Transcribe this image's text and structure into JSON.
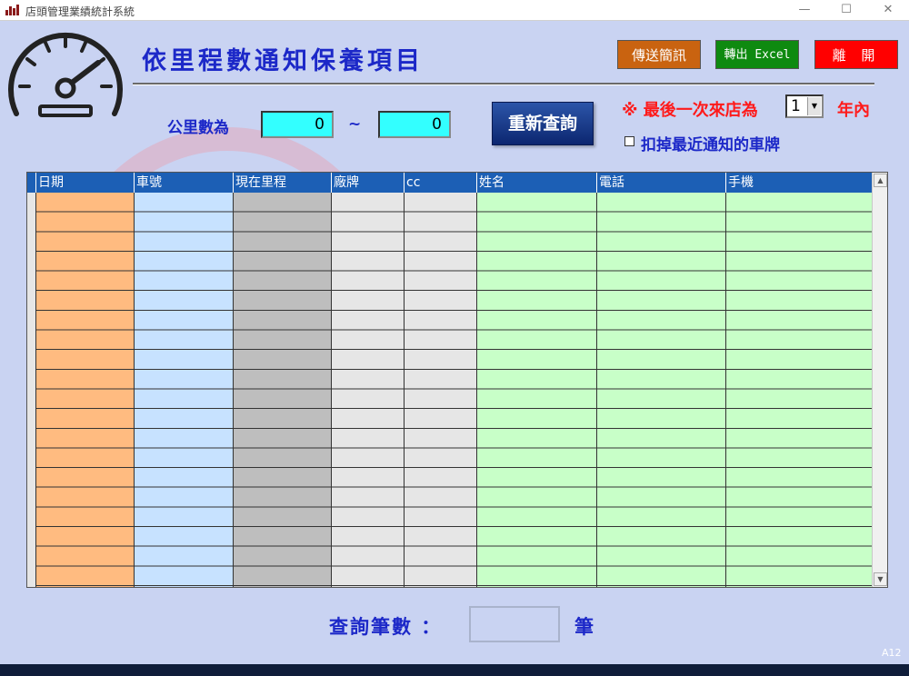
{
  "window": {
    "title": "店頭管理業績統計系統",
    "controls": [
      "—",
      "☐",
      "✕"
    ]
  },
  "header": {
    "page_title": "依里程數通知保養項目",
    "buttons": {
      "sms": "傳送簡訊",
      "excel": "轉出 Excel",
      "exit": "離 開"
    }
  },
  "filters": {
    "km_label": "公里數為",
    "km_from": "0",
    "km_separator": "~",
    "km_to": "0",
    "requery_label": "重新查詢",
    "last_visit_prefix": "※ 最後一次來店為",
    "last_visit_years": "1",
    "last_visit_suffix": "年內",
    "exclude_label": "扣掉最近通知的車牌",
    "exclude_checked": false
  },
  "grid": {
    "columns": [
      {
        "label": "日期",
        "color": "#ffbb80"
      },
      {
        "label": "車號",
        "color": "#c7e2ff"
      },
      {
        "label": "現在里程",
        "color": "#bebebe"
      },
      {
        "label": "廠牌",
        "color": "#e6e6e6"
      },
      {
        "label": "cc",
        "color": "#e6e6e6"
      },
      {
        "label": "姓名",
        "color": "#c8ffc8"
      },
      {
        "label": "電話",
        "color": "#c8ffc8"
      },
      {
        "label": "手機",
        "color": "#c8ffc8"
      }
    ],
    "header_color": "#1c5fb5",
    "rows": []
  },
  "footer": {
    "count_label": "查詢筆數 ：",
    "count_value": "",
    "count_unit": "筆",
    "form_code": "A12"
  },
  "colors": {
    "background": "#c9d3f2",
    "title_blue": "#1c28c8",
    "accent_red": "#ff1a1a"
  }
}
